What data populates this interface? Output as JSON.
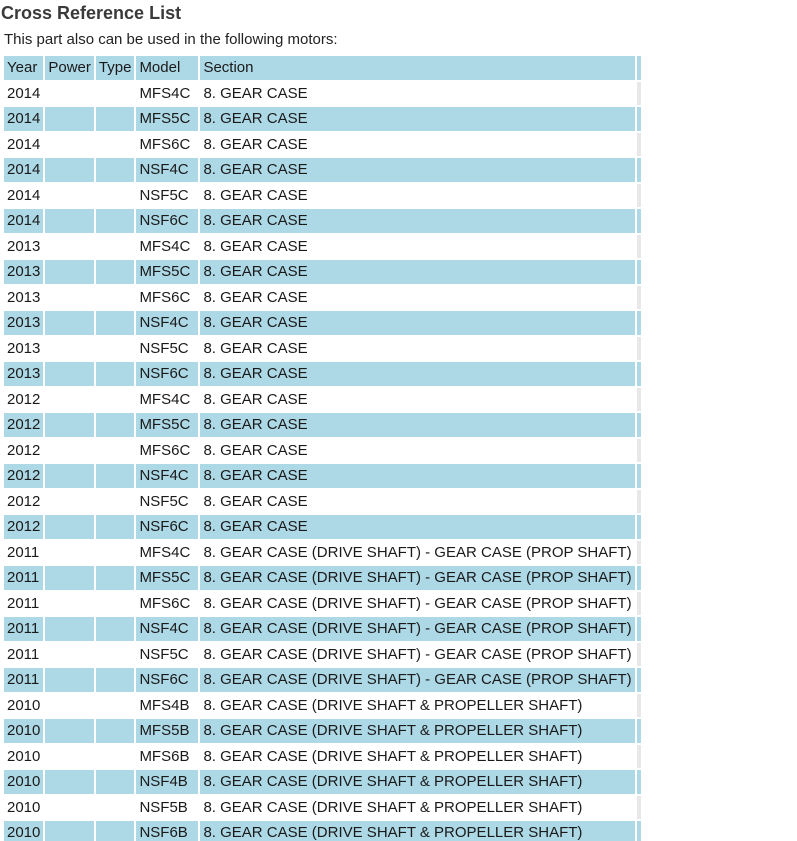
{
  "page": {
    "title": "Cross Reference List",
    "subtitle": "This part also can be used in the following motors:"
  },
  "table": {
    "headers": [
      "Year",
      "Power",
      "Type",
      "Model",
      "Section"
    ],
    "rows": [
      {
        "year": "2014",
        "power": "",
        "type": "",
        "model": "MFS4C",
        "section": "8. GEAR CASE"
      },
      {
        "year": "2014",
        "power": "",
        "type": "",
        "model": "MFS5C",
        "section": "8. GEAR CASE"
      },
      {
        "year": "2014",
        "power": "",
        "type": "",
        "model": "MFS6C",
        "section": "8. GEAR CASE"
      },
      {
        "year": "2014",
        "power": "",
        "type": "",
        "model": "NSF4C",
        "section": "8. GEAR CASE"
      },
      {
        "year": "2014",
        "power": "",
        "type": "",
        "model": "NSF5C",
        "section": "8. GEAR CASE"
      },
      {
        "year": "2014",
        "power": "",
        "type": "",
        "model": "NSF6C",
        "section": "8. GEAR CASE"
      },
      {
        "year": "2013",
        "power": "",
        "type": "",
        "model": "MFS4C",
        "section": "8. GEAR CASE"
      },
      {
        "year": "2013",
        "power": "",
        "type": "",
        "model": "MFS5C",
        "section": "8. GEAR CASE"
      },
      {
        "year": "2013",
        "power": "",
        "type": "",
        "model": "MFS6C",
        "section": "8. GEAR CASE"
      },
      {
        "year": "2013",
        "power": "",
        "type": "",
        "model": "NSF4C",
        "section": "8. GEAR CASE"
      },
      {
        "year": "2013",
        "power": "",
        "type": "",
        "model": "NSF5C",
        "section": "8. GEAR CASE"
      },
      {
        "year": "2013",
        "power": "",
        "type": "",
        "model": "NSF6C",
        "section": "8. GEAR CASE"
      },
      {
        "year": "2012",
        "power": "",
        "type": "",
        "model": "MFS4C",
        "section": "8. GEAR CASE"
      },
      {
        "year": "2012",
        "power": "",
        "type": "",
        "model": "MFS5C",
        "section": "8. GEAR CASE"
      },
      {
        "year": "2012",
        "power": "",
        "type": "",
        "model": "MFS6C",
        "section": "8. GEAR CASE"
      },
      {
        "year": "2012",
        "power": "",
        "type": "",
        "model": "NSF4C",
        "section": "8. GEAR CASE"
      },
      {
        "year": "2012",
        "power": "",
        "type": "",
        "model": "NSF5C",
        "section": "8. GEAR CASE"
      },
      {
        "year": "2012",
        "power": "",
        "type": "",
        "model": "NSF6C",
        "section": "8. GEAR CASE"
      },
      {
        "year": "2011",
        "power": "",
        "type": "",
        "model": "MFS4C",
        "section": "8. GEAR CASE (DRIVE SHAFT) - GEAR CASE (PROP SHAFT)"
      },
      {
        "year": "2011",
        "power": "",
        "type": "",
        "model": "MFS5C",
        "section": "8. GEAR CASE (DRIVE SHAFT) - GEAR CASE (PROP SHAFT)"
      },
      {
        "year": "2011",
        "power": "",
        "type": "",
        "model": "MFS6C",
        "section": "8. GEAR CASE (DRIVE SHAFT) - GEAR CASE (PROP SHAFT)"
      },
      {
        "year": "2011",
        "power": "",
        "type": "",
        "model": "NSF4C",
        "section": "8. GEAR CASE (DRIVE SHAFT) - GEAR CASE (PROP SHAFT)"
      },
      {
        "year": "2011",
        "power": "",
        "type": "",
        "model": "NSF5C",
        "section": "8. GEAR CASE (DRIVE SHAFT) - GEAR CASE (PROP SHAFT)"
      },
      {
        "year": "2011",
        "power": "",
        "type": "",
        "model": "NSF6C",
        "section": "8. GEAR CASE (DRIVE SHAFT) - GEAR CASE (PROP SHAFT)"
      },
      {
        "year": "2010",
        "power": "",
        "type": "",
        "model": "MFS4B",
        "section": "8. GEAR CASE (DRIVE SHAFT & PROPELLER SHAFT)"
      },
      {
        "year": "2010",
        "power": "",
        "type": "",
        "model": "MFS5B",
        "section": "8. GEAR CASE (DRIVE SHAFT & PROPELLER SHAFT)"
      },
      {
        "year": "2010",
        "power": "",
        "type": "",
        "model": "MFS6B",
        "section": "8. GEAR CASE (DRIVE SHAFT & PROPELLER SHAFT)"
      },
      {
        "year": "2010",
        "power": "",
        "type": "",
        "model": "NSF4B",
        "section": "8. GEAR CASE (DRIVE SHAFT & PROPELLER SHAFT)"
      },
      {
        "year": "2010",
        "power": "",
        "type": "",
        "model": "NSF5B",
        "section": "8. GEAR CASE (DRIVE SHAFT & PROPELLER SHAFT)"
      },
      {
        "year": "2010",
        "power": "",
        "type": "",
        "model": "NSF6B",
        "section": "8. GEAR CASE (DRIVE SHAFT & PROPELLER SHAFT)"
      }
    ]
  },
  "colors": {
    "row_highlight": "#add8e6",
    "row_plain": "#ffffff",
    "title_text": "#3a3a3a"
  }
}
